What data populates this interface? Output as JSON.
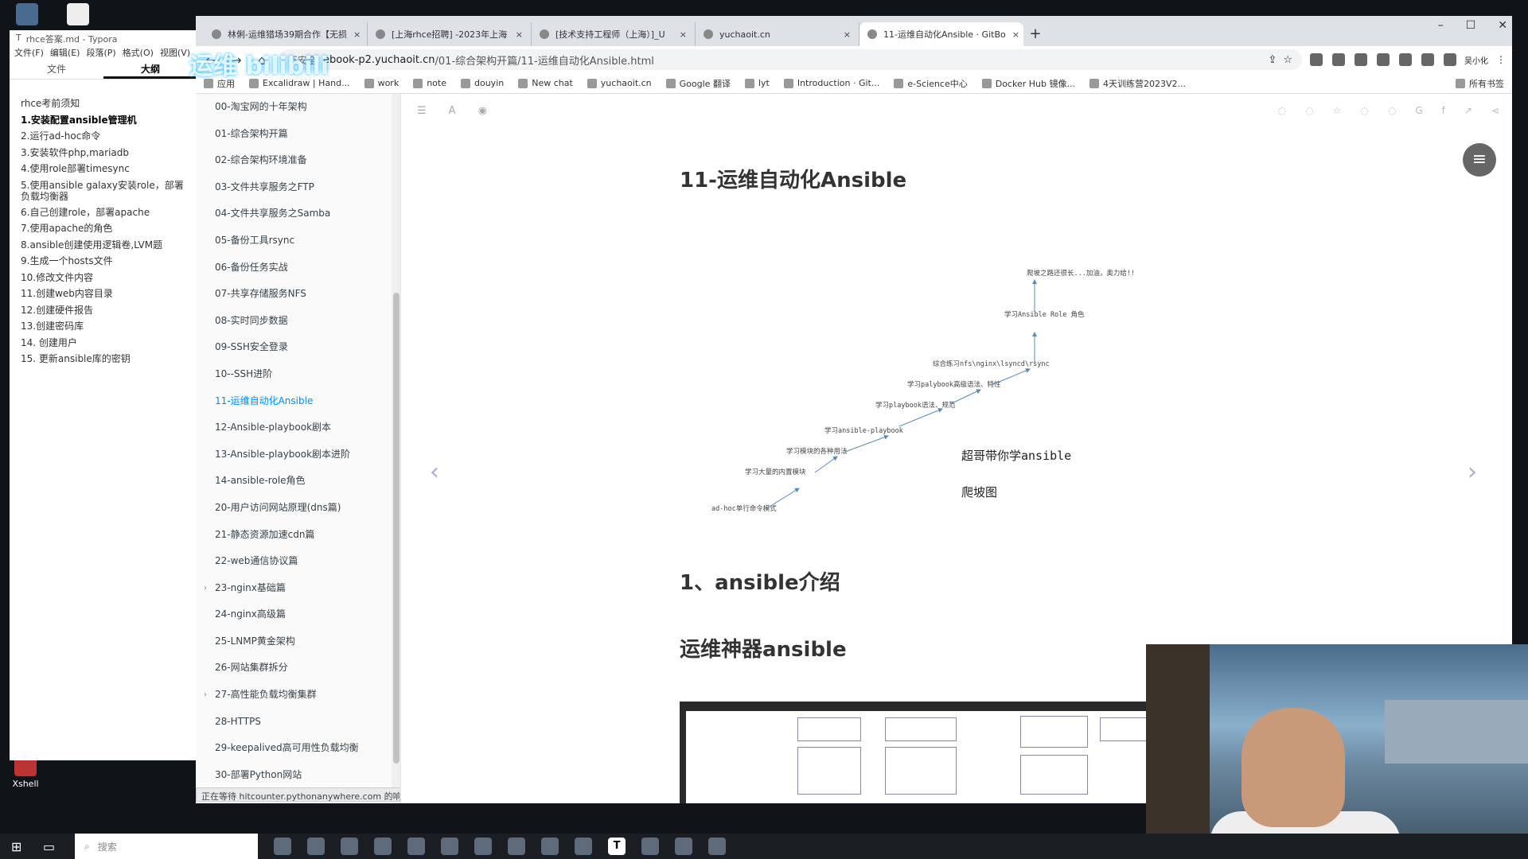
{
  "desktop": {
    "icons": [
      {
        "label": ""
      },
      {
        "label": ""
      },
      {
        "label": "Xshell"
      }
    ]
  },
  "overlay_logo": "运维  bilibili",
  "typora": {
    "title": "rhce答案.md - Typora",
    "menu": [
      "文件(F)",
      "编辑(E)",
      "段落(P)",
      "格式(O)",
      "视图(V)"
    ],
    "tabs": [
      "文件",
      "大纲"
    ],
    "outline": [
      "rhce考前须知",
      "1.安装配置ansible管理机",
      "2.运行ad-hoc命令",
      "3.安装软件php,mariadb",
      "4.使用role部署timesync",
      "5.使用ansible galaxy安装role，部署负载均衡器",
      "6.自己创建role，部署apache",
      "7.使用apache的角色",
      "8.ansible创建使用逻辑卷,LVM题",
      "9.生成一个hosts文件",
      "10.修改文件内容",
      "11.创建web内容目录",
      "12.创建硬件报告",
      "13.创建密码库",
      "14. 创建用户",
      "15. 更新ansible库的密钥"
    ]
  },
  "browser": {
    "tabs": [
      {
        "title": "林俐-运维猎场39期合作【无损"
      },
      {
        "title": "[上海rhce招聘] -2023年上海"
      },
      {
        "title": "[技术支持工程师（上海）]_U"
      },
      {
        "title": "yuchaoit.cn"
      },
      {
        "title": "11-运维自动化Ansible · GitBo"
      }
    ],
    "url": {
      "insecure": "不安全",
      "host": "ebook-p2.yuchaoit.cn",
      "path": "/01-综合架构开篇/11-运维自动化Ansible.html"
    },
    "profile_label": "吴小化",
    "bookmarks": [
      "应用",
      "Excalidraw | Hand...",
      "work",
      "note",
      "douyin",
      "New chat",
      "yuchaoit.cn",
      "Google 翻译",
      "lyt",
      "Introduction · Git...",
      "e-Science中心",
      "Docker Hub 镜像...",
      "4天训练营2023V2..."
    ],
    "bookmarks_right": "所有书签",
    "status": "正在等待 hitcounter.pythonanywhere.com 的响应..."
  },
  "sidebar": {
    "items": [
      {
        "label": "00-淘宝网的十年架构"
      },
      {
        "label": "01-综合架构开篇"
      },
      {
        "label": "02-综合架构环境准备"
      },
      {
        "label": "03-文件共享服务之FTP"
      },
      {
        "label": "04-文件共享服务之Samba"
      },
      {
        "label": "05-备份工具rsync"
      },
      {
        "label": "06-备份任务实战"
      },
      {
        "label": "07-共享存储服务NFS"
      },
      {
        "label": "08-实时同步数据"
      },
      {
        "label": "09-SSH安全登录"
      },
      {
        "label": "10--SSH进阶"
      },
      {
        "label": "11-运维自动化Ansible"
      },
      {
        "label": "12-Ansible-playbook剧本"
      },
      {
        "label": "13-Ansible-playbook剧本进阶"
      },
      {
        "label": "14-ansible-role角色"
      },
      {
        "label": "20-用户访问网站原理(dns篇)"
      },
      {
        "label": "21-静态资源加速cdn篇"
      },
      {
        "label": "22-web通信协议篇"
      },
      {
        "label": "23-nginx基础篇"
      },
      {
        "label": "24-nginx高级篇"
      },
      {
        "label": "25-LNMP黄金架构"
      },
      {
        "label": "26-网站集群拆分"
      },
      {
        "label": "27-高性能负载均衡集群"
      },
      {
        "label": "28-HTTPS"
      },
      {
        "label": "29-keepalived高可用性负载均衡"
      },
      {
        "label": "30-部署Python网站"
      }
    ],
    "active_index": 11,
    "expandable_indices": [
      18,
      22
    ]
  },
  "article": {
    "title": "11-运维自动化Ansible",
    "climb_steps": [
      "ad-hoc单行命令模式",
      "学习大量的内置模块",
      "学习模块的各种用法",
      "学习ansible-playbook",
      "学习playbook语法、规范",
      "学习palybook高级语法、特性",
      "综合练习nfs\\nginx\\lsyncd\\rsync",
      "学习Ansible Role 角色",
      "爬坡之路还很长...加油，奥力给!!"
    ],
    "climb_note_1": "超哥带你学ansible",
    "climb_note_2": "爬坡图",
    "section1": "1、ansible介绍",
    "section2": "运维神器ansible"
  },
  "taskbar": {
    "search_placeholder": "搜索"
  }
}
